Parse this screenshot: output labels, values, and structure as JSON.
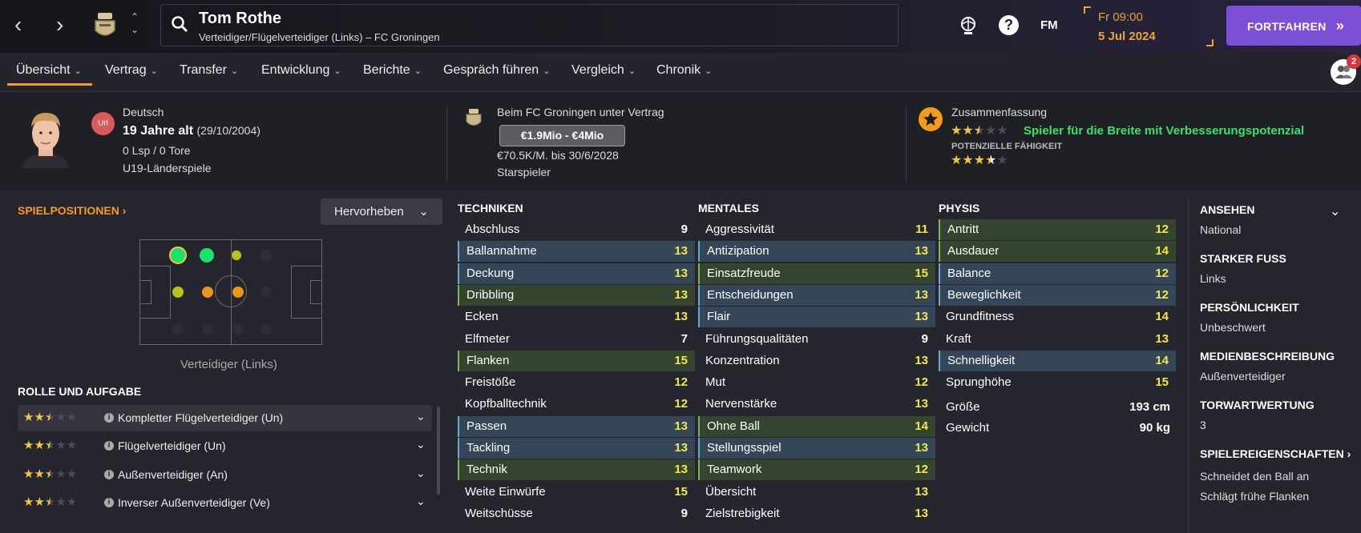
{
  "topbar": {
    "player_name": "Tom Rothe",
    "player_subtitle": "Verteidiger/Flügelverteidiger (Links) – FC Groningen",
    "fm_label": "FM",
    "day_time": "Fr 09:00",
    "date": "5 Jul 2024",
    "continue_label": "FORTFAHREN",
    "notif_count": "2"
  },
  "tabs": [
    {
      "label": "Übersicht"
    },
    {
      "label": "Vertrag"
    },
    {
      "label": "Transfer"
    },
    {
      "label": "Entwicklung"
    },
    {
      "label": "Berichte"
    },
    {
      "label": "Gespräch führen"
    },
    {
      "label": "Vergleich"
    },
    {
      "label": "Chronik"
    }
  ],
  "profile": {
    "flag_text": "Url",
    "nationality": "Deutsch",
    "age": "19 Jahre alt",
    "birthdate": "(29/10/2004)",
    "caps": "0 Lsp / 0 Tore",
    "youth_caps": "U19-Länderspiele"
  },
  "contract": {
    "club_status": "Beim FC Groningen unter Vertrag",
    "value_range": "€1.9Mio - €4Mio",
    "wage": "€70.5K/M. bis 30/6/2028",
    "status": "Starspieler"
  },
  "summary": {
    "title": "Zusammenfassung",
    "current_stars": 2.5,
    "description": "Spieler für die Breite mit Verbesserungspotenzial",
    "potential_label": "POTENZIELLE FÄHIGKEIT",
    "potential_stars": 3.5
  },
  "positions": {
    "title": "SPIELPOSITIONEN",
    "highlight_label": "Hervorheben",
    "position_label": "Verteidiger (Links)"
  },
  "roles": {
    "title": "ROLLE UND AUFGABE",
    "items": [
      {
        "stars": 2.5,
        "label": "Kompletter Flügelverteidiger (Un)"
      },
      {
        "stars": 2.5,
        "label": "Flügelverteidiger (Un)"
      },
      {
        "stars": 2.5,
        "label": "Außenverteidiger (An)"
      },
      {
        "stars": 2.5,
        "label": "Inverser Außenverteidiger (Ve)"
      }
    ]
  },
  "techniken": {
    "title": "TECHNIKEN",
    "items": [
      {
        "name": "Abschluss",
        "value": "9",
        "hl": "none",
        "color": "white"
      },
      {
        "name": "Ballannahme",
        "value": "13",
        "hl": "blue",
        "color": "yellow"
      },
      {
        "name": "Deckung",
        "value": "13",
        "hl": "blue",
        "color": "yellow"
      },
      {
        "name": "Dribbling",
        "value": "13",
        "hl": "green",
        "color": "yellow"
      },
      {
        "name": "Ecken",
        "value": "13",
        "hl": "none",
        "color": "yellow"
      },
      {
        "name": "Elfmeter",
        "value": "7",
        "hl": "none",
        "color": "white"
      },
      {
        "name": "Flanken",
        "value": "15",
        "hl": "green",
        "color": "yellow"
      },
      {
        "name": "Freistöße",
        "value": "12",
        "hl": "none",
        "color": "yellow"
      },
      {
        "name": "Kopfballtechnik",
        "value": "12",
        "hl": "none",
        "color": "yellow"
      },
      {
        "name": "Passen",
        "value": "13",
        "hl": "blue",
        "color": "yellow"
      },
      {
        "name": "Tackling",
        "value": "13",
        "hl": "blue",
        "color": "yellow"
      },
      {
        "name": "Technik",
        "value": "13",
        "hl": "green",
        "color": "yellow"
      },
      {
        "name": "Weite Einwürfe",
        "value": "15",
        "hl": "none",
        "color": "yellow"
      },
      {
        "name": "Weitschüsse",
        "value": "9",
        "hl": "none",
        "color": "white"
      }
    ]
  },
  "mentales": {
    "title": "MENTALES",
    "items": [
      {
        "name": "Aggressivität",
        "value": "11",
        "hl": "none",
        "color": "yellow"
      },
      {
        "name": "Antizipation",
        "value": "13",
        "hl": "blue",
        "color": "yellow"
      },
      {
        "name": "Einsatzfreude",
        "value": "15",
        "hl": "green",
        "color": "yellow"
      },
      {
        "name": "Entscheidungen",
        "value": "13",
        "hl": "blue",
        "color": "yellow"
      },
      {
        "name": "Flair",
        "value": "13",
        "hl": "blue",
        "color": "yellow"
      },
      {
        "name": "Führungsqualitäten",
        "value": "9",
        "hl": "none",
        "color": "white"
      },
      {
        "name": "Konzentration",
        "value": "13",
        "hl": "none",
        "color": "yellow"
      },
      {
        "name": "Mut",
        "value": "12",
        "hl": "none",
        "color": "yellow"
      },
      {
        "name": "Nervenstärke",
        "value": "13",
        "hl": "none",
        "color": "yellow"
      },
      {
        "name": "Ohne Ball",
        "value": "14",
        "hl": "green",
        "color": "yellow"
      },
      {
        "name": "Stellungsspiel",
        "value": "13",
        "hl": "blue",
        "color": "yellow"
      },
      {
        "name": "Teamwork",
        "value": "12",
        "hl": "green",
        "color": "yellow"
      },
      {
        "name": "Übersicht",
        "value": "13",
        "hl": "none",
        "color": "yellow"
      },
      {
        "name": "Zielstrebigkeit",
        "value": "13",
        "hl": "none",
        "color": "yellow"
      }
    ]
  },
  "physis": {
    "title": "PHYSIS",
    "items": [
      {
        "name": "Antritt",
        "value": "12",
        "hl": "green",
        "color": "yellow"
      },
      {
        "name": "Ausdauer",
        "value": "14",
        "hl": "green",
        "color": "yellow"
      },
      {
        "name": "Balance",
        "value": "12",
        "hl": "blue",
        "color": "yellow"
      },
      {
        "name": "Beweglichkeit",
        "value": "12",
        "hl": "blue",
        "color": "yellow"
      },
      {
        "name": "Grundfitness",
        "value": "14",
        "hl": "none",
        "color": "yellow"
      },
      {
        "name": "Kraft",
        "value": "13",
        "hl": "none",
        "color": "yellow"
      },
      {
        "name": "Schnelligkeit",
        "value": "14",
        "hl": "blue",
        "color": "yellow"
      },
      {
        "name": "Sprunghöhe",
        "value": "15",
        "hl": "none",
        "color": "yellow"
      }
    ],
    "height_label": "Größe",
    "height_value": "193 cm",
    "weight_label": "Gewicht",
    "weight_value": "90 kg"
  },
  "side": {
    "reputation_label": "ANSEHEN",
    "reputation_value": "National",
    "foot_label": "STARKER FUSS",
    "foot_value": "Links",
    "personality_label": "PERSÖNLICHKEIT",
    "personality_value": "Unbeschwert",
    "media_label": "MEDIENBESCHREIBUNG",
    "media_value": "Außenverteidiger",
    "gk_label": "TORWARTWERTUNG",
    "gk_value": "3",
    "traits_label": "SPIELEREIGENSCHAFTEN",
    "traits": [
      "Schneidet den Ball an",
      "Schlägt frühe Flanken"
    ]
  },
  "colors": {
    "accent_orange": "#f59a23",
    "continue_purple": "#7b4fd6",
    "attr_yellow": "#f4e64b",
    "summary_green": "#3be06a"
  }
}
